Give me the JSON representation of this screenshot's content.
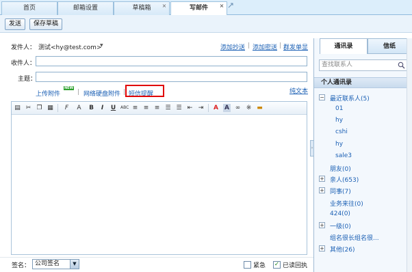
{
  "tabs": [
    {
      "label": "首页"
    },
    {
      "label": "邮箱设置"
    },
    {
      "label": "草稿箱"
    },
    {
      "label": "写邮件"
    }
  ],
  "toolbar": {
    "send_label": "发送",
    "save_draft_label": "保存草稿"
  },
  "compose": {
    "sender_label": "发件人：",
    "sender_value": "测试<hy@test.com>",
    "add_cc": "添加抄送",
    "add_bcc": "添加密送",
    "group_send": "群发单显",
    "to_label": "收件人：",
    "subject_label": "主题：",
    "upload_attachment": "上传附件",
    "netdisk_attachment": "网络硬盘附件",
    "sms_notify": "短信提醒",
    "plain_text": "纯文本",
    "new_badge": "NEW"
  },
  "bottom": {
    "signature_label": "签名：",
    "signature_value": "公司签名",
    "urgent_label": "紧急",
    "urgent_checked": false,
    "read_receipt_label": "已读回执",
    "read_receipt_checked": true
  },
  "panel": {
    "tab_contacts": "通讯录",
    "tab_stationery": "信纸",
    "search_placeholder": "查找联系人",
    "group_header": "个人通讯录",
    "tree": [
      {
        "label": "最近联系人(5)",
        "toggle": "−",
        "children": [
          "01",
          "hy",
          "cshi",
          "hy",
          "sale3"
        ]
      },
      {
        "label": "朋友(0)",
        "toggle": ""
      },
      {
        "label": "亲人(653)",
        "toggle": "+"
      },
      {
        "label": "同事(7)",
        "toggle": "+"
      },
      {
        "label": "业务来往(0)",
        "toggle": ""
      },
      {
        "label": "424(0)",
        "toggle": ""
      },
      {
        "label": "一级(0)",
        "toggle": "+"
      },
      {
        "label": "组名很长组名很...",
        "toggle": ""
      },
      {
        "label": "其他(26)",
        "toggle": "+"
      }
    ]
  },
  "icons": {
    "close": "×",
    "check": "✓",
    "dropdown": "▼",
    "collapse": "›"
  }
}
